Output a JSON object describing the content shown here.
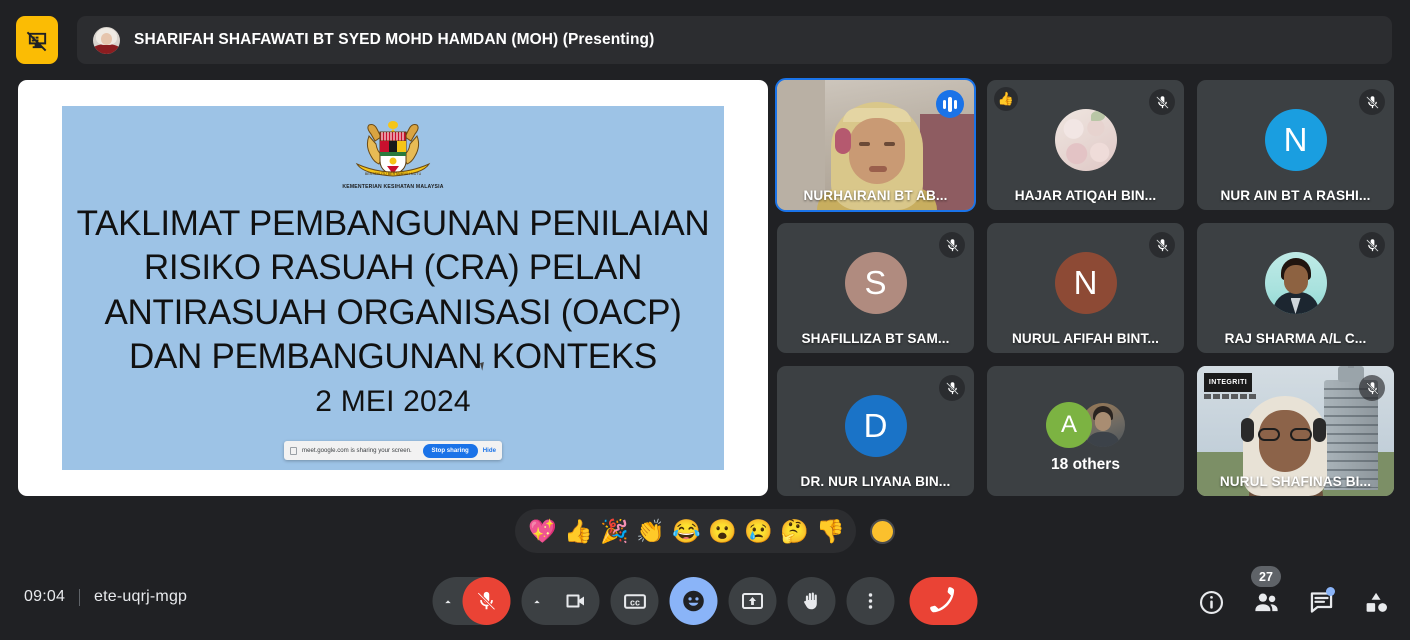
{
  "app": {
    "background_color": "#202124"
  },
  "topbar": {
    "present_icon": "present-stop-icon",
    "presenter_avatar": "presenter-avatar",
    "presenter_text": "SHARIFAH SHAFAWATI BT SYED MOHD HAMDAN (MOH) (Presenting)"
  },
  "presentation": {
    "slide_bg_color": "#9dc3e6",
    "crest_icon": "malaysia-coat-of-arms",
    "ministry": "KEMENTERIAN KESIHATAN MALAYSIA",
    "title_lines": [
      "TAKLIMAT PEMBANGUNAN PENILAIAN",
      "RISIKO RASUAH (CRA) PELAN",
      "ANTIRASUAH ORGANISASI (OACP)",
      "DAN PEMBANGUNAN KONTEKS"
    ],
    "date": "2 MEI 2024",
    "share_bar": {
      "message": "meet.google.com is sharing your screen.",
      "stop_label": "Stop sharing",
      "hide_label": "Hide"
    }
  },
  "participants": [
    {
      "name": "NURHAIRANI BT AB...",
      "type": "video",
      "speaking": true,
      "muted": false,
      "audio_indicator": true,
      "reaction": null
    },
    {
      "name": "HAJAR ATIQAH BIN...",
      "type": "photo-avatar",
      "avatar_style": "floral",
      "speaking": false,
      "muted": true,
      "reaction": "👍"
    },
    {
      "name": "NUR AIN BT A RASHI...",
      "type": "initial",
      "initial": "N",
      "avatar_color": "#1a9ee0",
      "speaking": false,
      "muted": true,
      "reaction": null
    },
    {
      "name": "SHAFILLIZA BT SAM...",
      "type": "initial",
      "initial": "S",
      "avatar_color": "#b08b7f",
      "speaking": false,
      "muted": true,
      "reaction": null
    },
    {
      "name": "NURUL AFIFAH BINT...",
      "type": "initial",
      "initial": "N",
      "avatar_color": "#8d4a35",
      "speaking": false,
      "muted": true,
      "reaction": null
    },
    {
      "name": "RAJ SHARMA A/L C...",
      "type": "photo-avatar",
      "avatar_style": "raj",
      "speaking": false,
      "muted": true,
      "reaction": null
    },
    {
      "name": "DR. NUR LIYANA BIN...",
      "type": "initial",
      "initial": "D",
      "avatar_color": "#1a73c7",
      "speaking": false,
      "muted": true,
      "reaction": null
    },
    {
      "name": "18 others",
      "type": "others",
      "others_count": 18,
      "avatar_initial": "A",
      "avatar_color": "#7cb342"
    },
    {
      "name": "NURUL SHAFINAS BI...",
      "type": "video",
      "speaking": false,
      "muted": true,
      "background_logo": "INTEGRITI"
    }
  ],
  "reactions": {
    "emojis": [
      "💖",
      "👍",
      "🎉",
      "👏",
      "😂",
      "😮",
      "😢",
      "🤔",
      "👎"
    ],
    "skin_tone_swatch": "#fbc02d"
  },
  "bottombar": {
    "time": "09:04",
    "meeting_code": "ete-uqrj-mgp",
    "controls": [
      {
        "name": "microphone-toggle",
        "icon": "mic-off-icon",
        "state": "muted",
        "color": "#ea4335"
      },
      {
        "name": "camera-toggle",
        "icon": "video-camera-icon",
        "state": "on"
      },
      {
        "name": "captions-toggle",
        "icon": "closed-captions-icon"
      },
      {
        "name": "reactions-toggle",
        "icon": "emoji-smile-icon",
        "state": "active",
        "color": "#8ab4f8"
      },
      {
        "name": "present-now",
        "icon": "present-screen-icon"
      },
      {
        "name": "raise-hand",
        "icon": "raised-hand-icon"
      },
      {
        "name": "more-options",
        "icon": "three-dots-vertical-icon"
      },
      {
        "name": "leave-call",
        "icon": "hangup-phone-icon",
        "color": "#ea4335"
      }
    ],
    "right_icons": [
      {
        "name": "meeting-details",
        "icon": "info-circle-icon",
        "badge": null
      },
      {
        "name": "show-everyone",
        "icon": "people-icon",
        "badge": "27"
      },
      {
        "name": "chat-with-everyone",
        "icon": "chat-bubble-icon",
        "badge": null,
        "dot": true
      },
      {
        "name": "activities",
        "icon": "activities-shapes-icon",
        "badge": null
      }
    ]
  }
}
